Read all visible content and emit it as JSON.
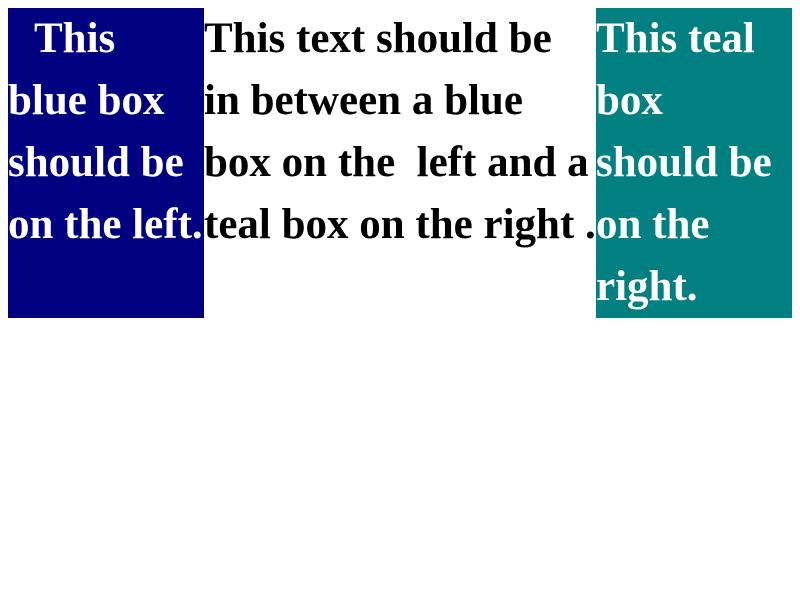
{
  "left_box": {
    "text": "This blue box should be on the left.",
    "color": "#000080"
  },
  "middle": {
    "text": "This text should be in between a blue box on the  left and a teal box on the right ."
  },
  "right_box": {
    "text": "This teal box should be on the right.",
    "color": "#008080"
  }
}
